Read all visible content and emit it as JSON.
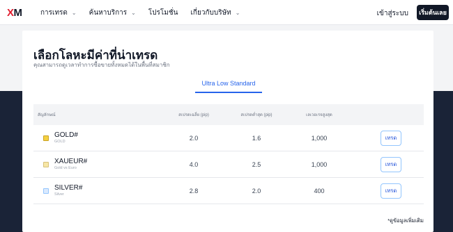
{
  "nav": {
    "logo_x": "X",
    "logo_m": "M",
    "items": [
      {
        "label": "การเทรด",
        "has_dropdown": true
      },
      {
        "label": "ค้นหาบริการ",
        "has_dropdown": true
      },
      {
        "label": "โปรโมชั่น",
        "has_dropdown": false
      },
      {
        "label": "เกี่ยวกับบริษัท",
        "has_dropdown": true
      }
    ],
    "login_label": "เข้าสู่ระบบ",
    "cta_label": "เริ่มต้นเลย"
  },
  "page": {
    "title": "เลือกโลหะมีค่าที่น่าเทรด",
    "subtitle": "คุณสามารถดูเวลาทำการซื้อขายทั้งหมดได้ในพื้นที่สมาชิก",
    "active_tab": "Ultra Low Standard"
  },
  "table": {
    "headers": [
      "สัญลักษณ์",
      "สเปรดเฉลี่ย (pip)",
      "สเปรดต่ำสุด (pip)",
      "เลเวอเรจสูงสุด",
      ""
    ],
    "rows": [
      {
        "symbol": "GOLD#",
        "desc": "GOLD",
        "avg_spread": "2.0",
        "min_spread": "1.6",
        "leverage": "1,000",
        "action": "เทรด",
        "icon": "gold-icon"
      },
      {
        "symbol": "XAUEUR#",
        "desc": "Gold vs Euro",
        "avg_spread": "4.0",
        "min_spread": "2.5",
        "leverage": "1,000",
        "action": "เทรด",
        "icon": "xaueur-icon"
      },
      {
        "symbol": "SILVER#",
        "desc": "Silver",
        "avg_spread": "2.8",
        "min_spread": "2.0",
        "leverage": "400",
        "action": "เทรด",
        "icon": "silver-icon"
      }
    ]
  },
  "footnote": "*ดูข้อมูลเพิ่มเติม",
  "colors": {
    "accent": "#2563eb",
    "dark_band": "#1a2337",
    "brand_red": "#e11d2e"
  }
}
